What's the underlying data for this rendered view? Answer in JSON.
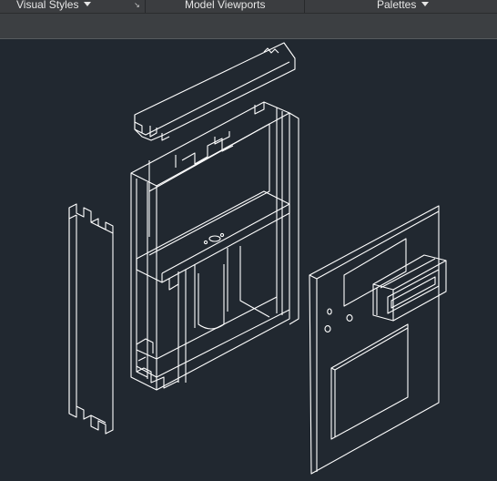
{
  "ribbon": {
    "panels": [
      {
        "label": "Visual Styles",
        "has_dropdown": true
      },
      {
        "label": "Model Viewports",
        "has_dropdown": false
      },
      {
        "label": "Palettes",
        "has_dropdown": true
      }
    ],
    "launcher_icon": "dialog-launcher-arrow-icon"
  },
  "viewport": {
    "background": "#212830",
    "linework": "#ffffff",
    "content": "isometric-wireframe-exploded-enclosure"
  }
}
